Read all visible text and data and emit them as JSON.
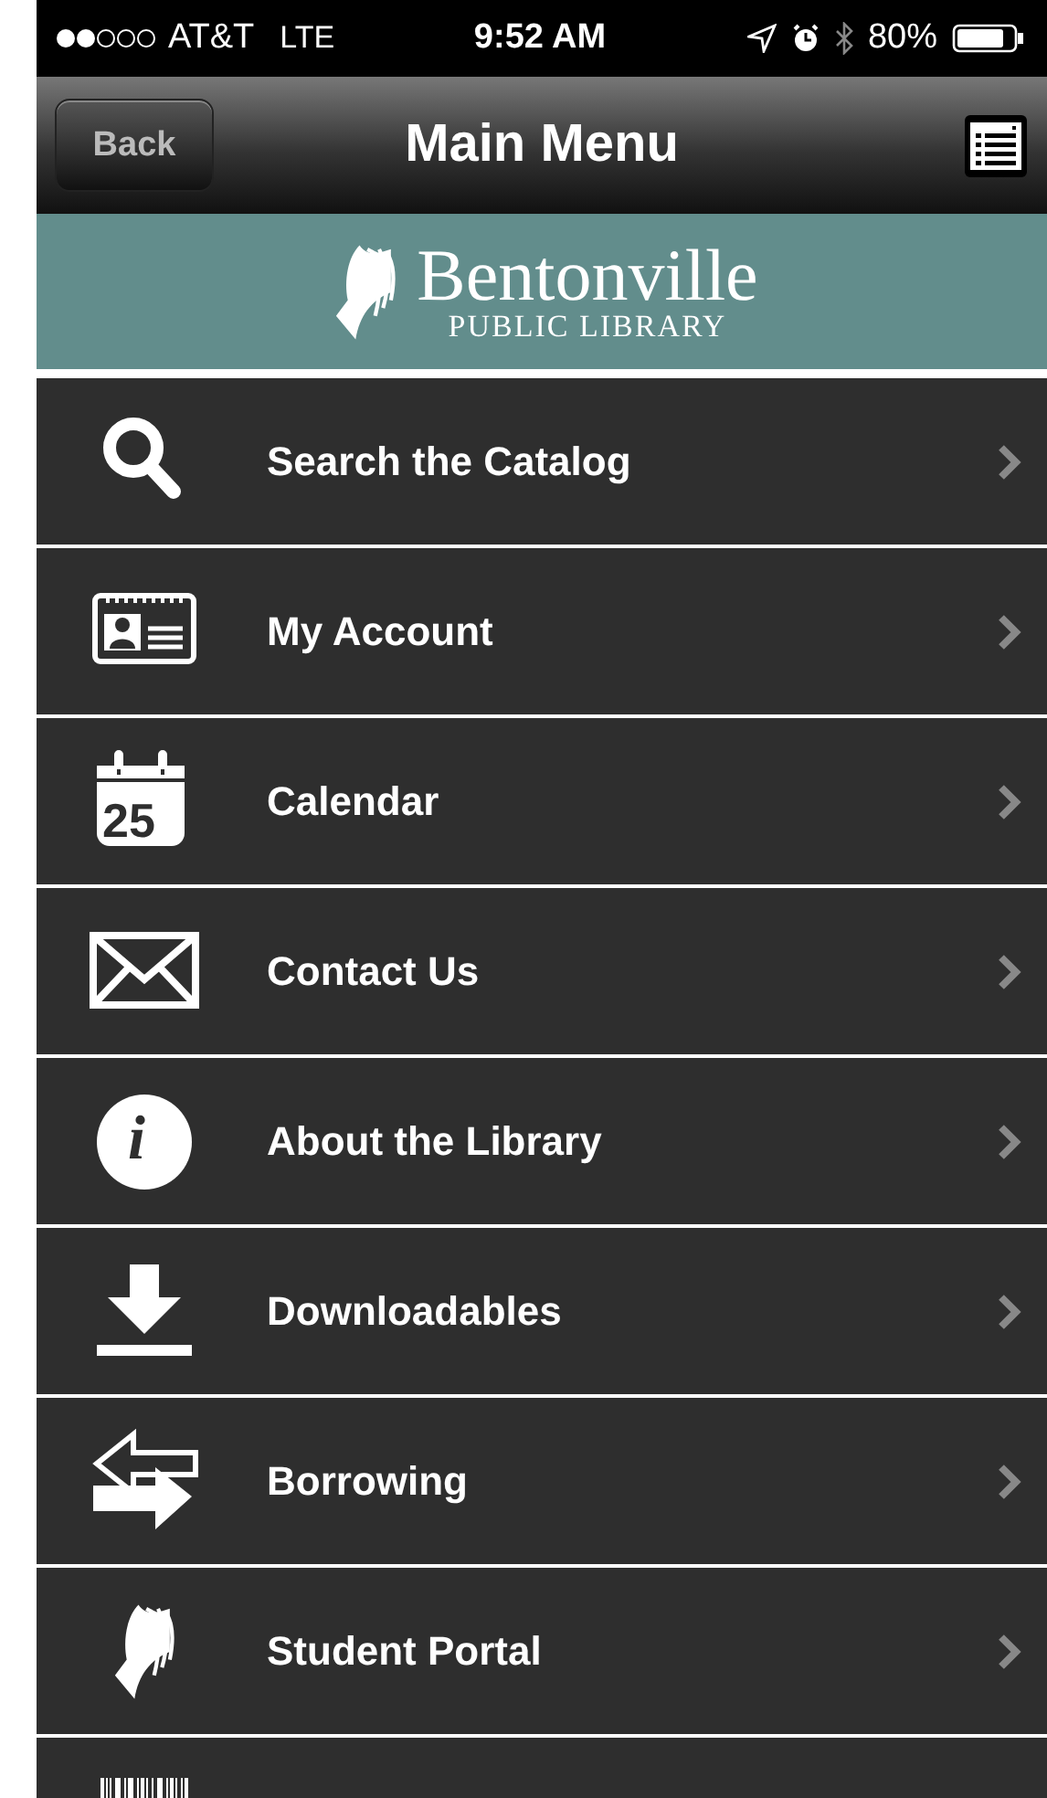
{
  "status_bar": {
    "carrier": "AT&T",
    "network": "LTE",
    "time": "9:52 AM",
    "battery": "80%"
  },
  "nav_bar": {
    "back": "Back",
    "title": "Main Menu"
  },
  "banner": {
    "name": "Bentonville",
    "subtitle": "PUBLIC LIBRARY"
  },
  "menu": [
    {
      "kind": "search",
      "label": "Search the Catalog"
    },
    {
      "kind": "account",
      "label": "My Account"
    },
    {
      "kind": "calendar",
      "label": "Calendar",
      "icon_text": "25"
    },
    {
      "kind": "mail",
      "label": "Contact Us"
    },
    {
      "kind": "info",
      "label": "About the Library",
      "icon_text": "i"
    },
    {
      "kind": "download",
      "label": "Downloadables"
    },
    {
      "kind": "exchange",
      "label": "Borrowing"
    },
    {
      "kind": "book",
      "label": "Student Portal"
    },
    {
      "kind": "barcode"
    }
  ]
}
